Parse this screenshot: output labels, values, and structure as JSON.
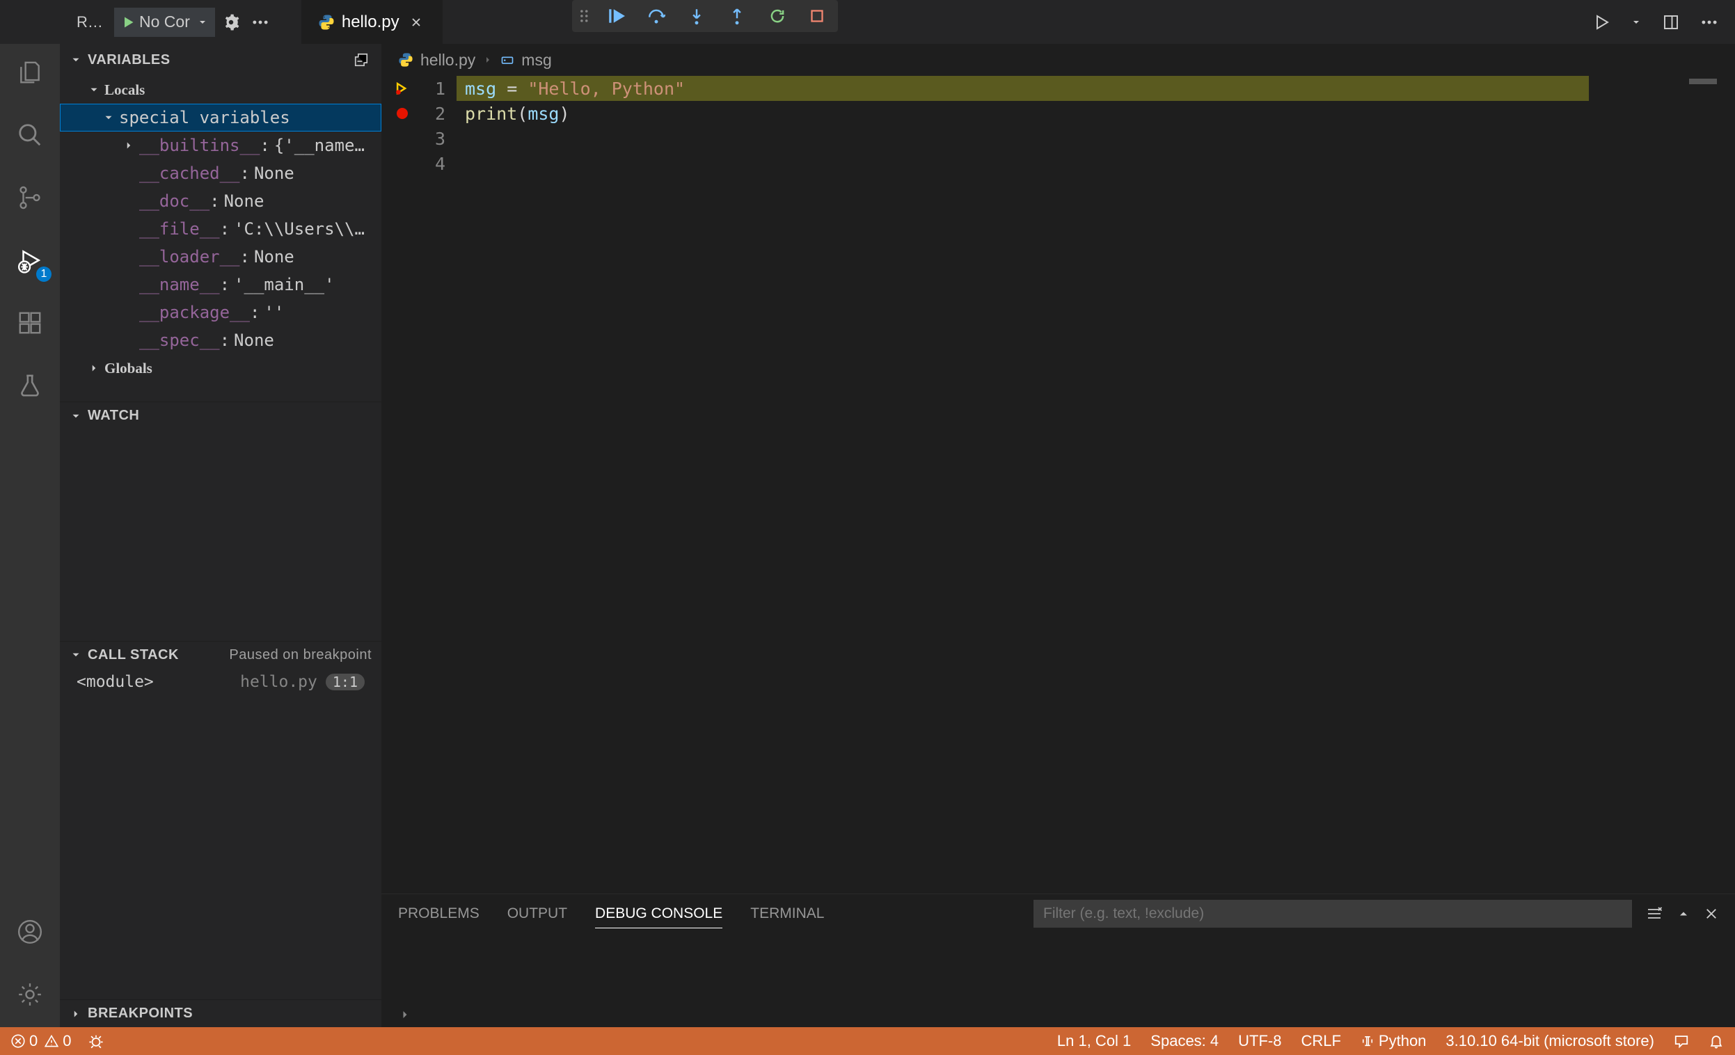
{
  "titlebar": {
    "run_label": "RU...",
    "config_text": "No Cor",
    "tab_filename": "hello.py"
  },
  "debug_toolbar": {
    "icons": [
      "continue",
      "step-over",
      "step-into",
      "step-out",
      "restart",
      "stop"
    ]
  },
  "sidebar": {
    "variables_header": "VARIABLES",
    "watch_header": "WATCH",
    "callstack_header": "CALL STACK",
    "callstack_status": "Paused on breakpoint",
    "breakpoints_header": "BREAKPOINTS",
    "scopes": {
      "locals": "Locals",
      "globals": "Globals",
      "special_vars": "special variables"
    },
    "vars": [
      {
        "name": "__builtins__",
        "value": "{'__name…"
      },
      {
        "name": "__cached__",
        "value": "None"
      },
      {
        "name": "__doc__",
        "value": "None"
      },
      {
        "name": "__file__",
        "value": "'C:\\\\Users\\\\…"
      },
      {
        "name": "__loader__",
        "value": "None"
      },
      {
        "name": "__name__",
        "value": "'__main__'"
      },
      {
        "name": "__package__",
        "value": "''"
      },
      {
        "name": "__spec__",
        "value": "None"
      }
    ],
    "callstack": {
      "frame": "<module>",
      "file": "hello.py",
      "pos": "1:1"
    }
  },
  "breadcrumb": {
    "file": "hello.py",
    "symbol": "msg"
  },
  "editor": {
    "lines": [
      "1",
      "2",
      "3",
      "4"
    ],
    "code": {
      "l1_var": "msg",
      "l1_op": " = ",
      "l1_str": "\"Hello, Python\"",
      "l2_fn": "print",
      "l2_open": "(",
      "l2_arg": "msg",
      "l2_close": ")"
    }
  },
  "panel": {
    "tabs": {
      "problems": "PROBLEMS",
      "output": "OUTPUT",
      "debug_console": "DEBUG CONSOLE",
      "terminal": "TERMINAL"
    },
    "filter_placeholder": "Filter (e.g. text, !exclude)"
  },
  "statusbar": {
    "errors": "0",
    "warnings": "0",
    "lncol": "Ln 1, Col 1",
    "spaces": "Spaces: 4",
    "encoding": "UTF-8",
    "eol": "CRLF",
    "lang": "Python",
    "interpreter": "3.10.10 64-bit (microsoft store)"
  },
  "activity_badge": "1"
}
